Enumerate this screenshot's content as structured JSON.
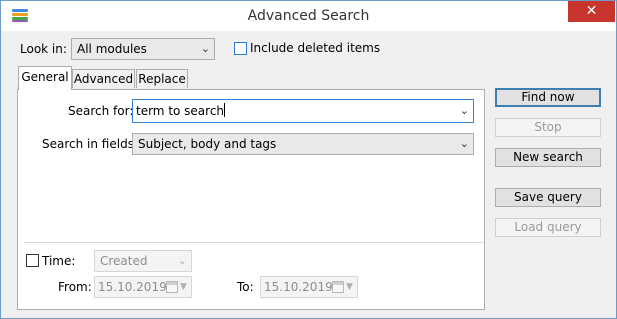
{
  "window": {
    "title": "Advanced Search",
    "close_glyph": "✕",
    "icon": "stacked-layers-icon"
  },
  "look_in": {
    "label": "Look in:",
    "value": "All modules"
  },
  "include_deleted": {
    "label": "Include deleted items",
    "checked": false
  },
  "tabs": [
    {
      "label": "General",
      "active": true
    },
    {
      "label": "Advanced",
      "active": false
    },
    {
      "label": "Replace",
      "active": false
    }
  ],
  "search_for": {
    "label": "Search for:",
    "value": "term to search"
  },
  "search_in_fields": {
    "label": "Search in fields:",
    "value": "Subject, body and tags"
  },
  "time": {
    "label": "Time:",
    "checked": false,
    "type_value": "Created",
    "from_label": "From:",
    "from_value": "15.10.2019",
    "to_label": "To:",
    "to_value": "15.10.2019"
  },
  "buttons": {
    "find_now": "Find now",
    "stop": "Stop",
    "new_search": "New search",
    "save_query": "Save query",
    "load_query": "Load query"
  },
  "colors": {
    "title_close_bg": "#c7352c",
    "focus_border": "#3b84d1",
    "window_bg": "#f0f0f0"
  }
}
